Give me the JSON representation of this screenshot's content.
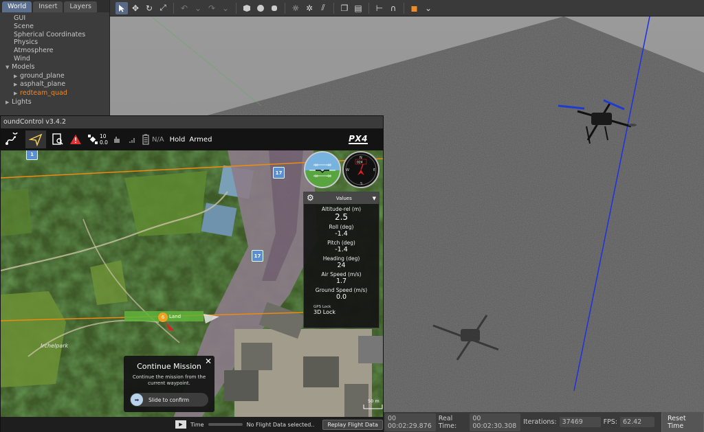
{
  "gazebo": {
    "tabs": [
      "World",
      "Insert",
      "Layers"
    ],
    "tree": {
      "gui": "GUI",
      "scene": "Scene",
      "spherical": "Spherical Coordinates",
      "physics": "Physics",
      "atmosphere": "Atmosphere",
      "wind": "Wind",
      "models": "Models",
      "model_items": [
        "ground_plane",
        "asphalt_plane",
        "redteam_quad"
      ],
      "lights": "Lights"
    },
    "bottom": {
      "sim_time": "00 00:02:29.876",
      "real_time_label": "Real Time:",
      "real_time": "00 00:02:30.308",
      "iterations_label": "Iterations:",
      "iterations": "37469",
      "fps_label": "FPS:",
      "fps": "62.42",
      "reset_label": "Reset Time"
    }
  },
  "qgc": {
    "title": "oundControl v3.4.2",
    "gps_count": "10",
    "hdop": "0.0",
    "battery": "N/A",
    "flight_mode": "Hold",
    "arm_state": "Armed",
    "brand": "PX4",
    "waypoints": [
      "1",
      "17",
      "17"
    ],
    "land_marker": "6",
    "land_label": "Land",
    "park_label": "Irchelpark",
    "scale_label": "50 m",
    "values_panel": {
      "title": "Values",
      "rows": [
        {
          "label": "Altitude-rel (m)",
          "value": "2.5"
        },
        {
          "label": "Roll (deg)",
          "value": "-1.4"
        },
        {
          "label": "Pitch (deg)",
          "value": "-1.4"
        },
        {
          "label": "Heading (deg)",
          "value": "24"
        },
        {
          "label": "Air Speed (m/s)",
          "value": "1.7"
        },
        {
          "label": "Ground Speed (m/s)",
          "value": "0.0"
        }
      ],
      "gps_lock_label": "GPS Lock",
      "gps_lock_value": "3D Lock"
    },
    "continue_mission": {
      "title": "Continue Mission",
      "desc": "Continue the mission from the current waypoint.",
      "slider": "Slide to confirm"
    },
    "bottom": {
      "time_label": "Time",
      "status": "No Flight Data selected..",
      "replay": "Replay Flight Data"
    }
  }
}
